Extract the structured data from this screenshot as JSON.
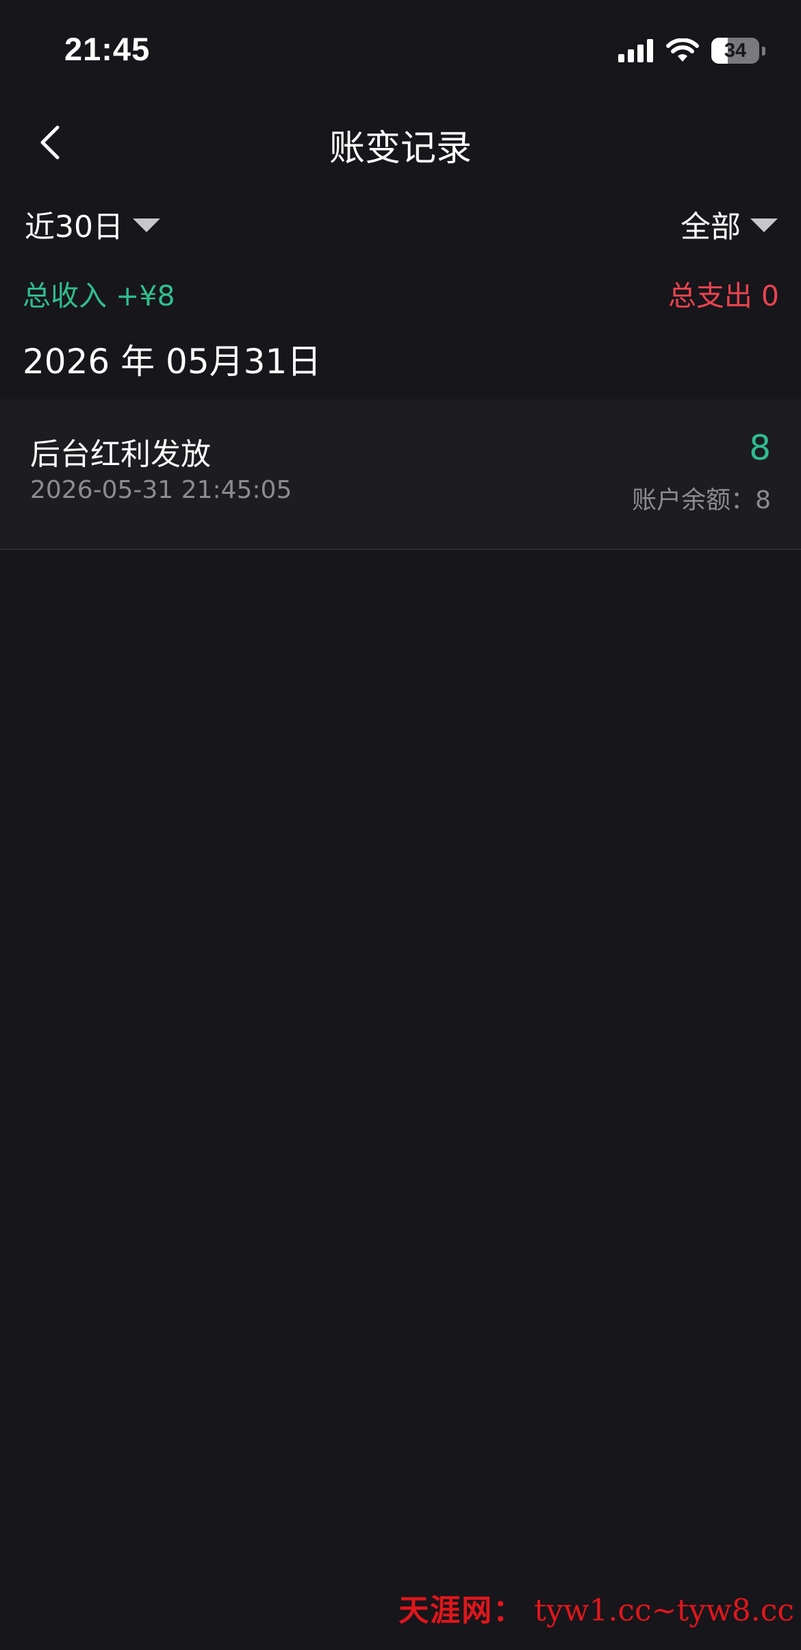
{
  "status_bar": {
    "time": "21:45",
    "battery_level": "34",
    "battery_fraction": 0.34
  },
  "nav": {
    "title": "账变记录"
  },
  "filters": {
    "date_range": "近30日",
    "type": "全部"
  },
  "summary": {
    "income": "总收入 +¥8",
    "expense": "总支出 0"
  },
  "groups": [
    {
      "date": "2026 年 05月31日",
      "records": [
        {
          "title": "后台红利发放",
          "time": "2026-05-31 21:45:05",
          "amount": "8",
          "balance": "账户余额：8"
        }
      ]
    }
  ],
  "watermark": {
    "brand": "天涯网：",
    "urls": "tyw1.cc~tyw8.cc"
  },
  "colors": {
    "background": "#17161b",
    "income": "#2fbe8d",
    "expense": "#e8444f",
    "secondary_text": "#8c8b90"
  }
}
